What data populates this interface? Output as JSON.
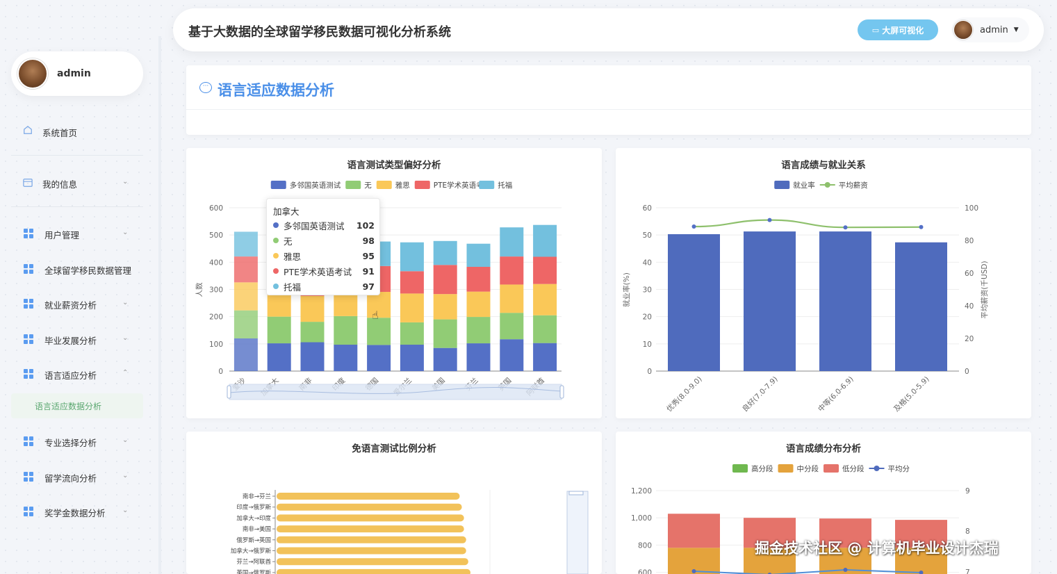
{
  "sidebar": {
    "user_name": "admin",
    "items": [
      {
        "label": "系统首页",
        "icon": "home-icon",
        "has_chevron": false
      },
      {
        "label": "我的信息",
        "icon": "card-icon",
        "has_chevron": true
      },
      {
        "label": "用户管理",
        "icon": "grid-icon",
        "has_chevron": true
      },
      {
        "label": "全球留学移民数据管理",
        "icon": "grid-icon",
        "has_chevron": false
      },
      {
        "label": "就业薪资分析",
        "icon": "grid-icon",
        "has_chevron": true
      },
      {
        "label": "毕业发展分析",
        "icon": "grid-icon",
        "has_chevron": true
      },
      {
        "label": "语言适应分析",
        "icon": "grid-icon",
        "has_chevron": true,
        "expanded": true
      },
      {
        "label": "专业选择分析",
        "icon": "grid-icon",
        "has_chevron": true
      },
      {
        "label": "留学流向分析",
        "icon": "grid-icon",
        "has_chevron": true
      },
      {
        "label": "奖学金数据分析",
        "icon": "grid-icon",
        "has_chevron": true
      }
    ],
    "active_sub_item": "语言适应数据分析"
  },
  "header": {
    "title": "基于大数据的全球留学移民数据可视化分析系统",
    "bigscreen_label": "大屏可视化",
    "user_name": "admin"
  },
  "page": {
    "title": "语言适应数据分析"
  },
  "colors": {
    "accent": "#4a8fe8",
    "blue": "#5470c6",
    "green": "#91cc75",
    "yellow": "#fac858",
    "red": "#ee6666",
    "cyan": "#73c0de",
    "bar_blue": "#4f6bbd",
    "line_green": "#8ec06c",
    "high": "#6fb84f",
    "mid": "#e4a33c",
    "low": "#e5736a"
  },
  "tooltip": {
    "title": "加拿大",
    "rows": [
      {
        "name": "多邻国英语测试",
        "value": "102",
        "color": "#5470c6"
      },
      {
        "name": "无",
        "value": "98",
        "color": "#91cc75"
      },
      {
        "name": "雅思",
        "value": "95",
        "color": "#fac858"
      },
      {
        "name": "PTE学术英语考试",
        "value": "91",
        "color": "#ee6666"
      },
      {
        "name": "托福",
        "value": "97",
        "color": "#73c0de"
      }
    ]
  },
  "watermark": "掘金技术社区 @ 计算机毕业设计杰瑞",
  "chart_data": [
    {
      "type": "bar",
      "stacked": true,
      "title": "语言测试类型偏好分析",
      "ylabel": "人数",
      "ylim": [
        0,
        600
      ],
      "yticks": [
        "0",
        "100",
        "200",
        "300",
        "400",
        "500",
        "600"
      ],
      "categories": [
        "爱沙",
        "加拿大",
        "南非",
        "印度",
        "德国",
        "爱尔兰",
        "美国",
        "芬兰",
        "英国",
        "阿联酋"
      ],
      "series": [
        {
          "name": "多邻国英语测试",
          "color": "#5470c6",
          "values": [
            120,
            102,
            106,
            97,
            96,
            97,
            85,
            102,
            117,
            103
          ]
        },
        {
          "name": "无",
          "color": "#91cc75",
          "values": [
            103,
            98,
            75,
            105,
            100,
            82,
            105,
            97,
            97,
            102
          ]
        },
        {
          "name": "雅思",
          "color": "#fac858",
          "values": [
            103,
            95,
            95,
            90,
            95,
            106,
            93,
            93,
            104,
            115
          ]
        },
        {
          "name": "PTE学术英语考试",
          "color": "#ee6666",
          "values": [
            95,
            91,
            105,
            96,
            95,
            82,
            107,
            91,
            103,
            100
          ]
        },
        {
          "name": "托福",
          "color": "#73c0de",
          "values": [
            91,
            97,
            120,
            106,
            90,
            106,
            88,
            85,
            107,
            117
          ]
        }
      ],
      "legend_position": "top-center"
    },
    {
      "type": "bar",
      "title": "语言成绩与就业关系",
      "categories": [
        "优秀(8.0-9.0)",
        "良好(7.0-7.9)",
        "中等(6.0-6.9)",
        "及格(5.0-5.9)"
      ],
      "ylabel": "就业率(%)",
      "y2label": "平均薪资(千USD)",
      "ylim": [
        0,
        60
      ],
      "y2lim": [
        0,
        100
      ],
      "yticks": [
        "0",
        "10",
        "20",
        "30",
        "40",
        "50",
        "60"
      ],
      "y2ticks": [
        "0",
        "20",
        "40",
        "60",
        "80",
        "100"
      ],
      "series": [
        {
          "name": "就业率",
          "type": "bar",
          "color": "#4f6bbd",
          "values": [
            50.3,
            51.3,
            51.3,
            47.3
          ]
        },
        {
          "name": "平均薪资",
          "type": "line",
          "color": "#8ec06c",
          "axis": "right",
          "values": [
            88.5,
            92.5,
            88.0,
            88.2
          ]
        }
      ],
      "legend_position": "top-center"
    },
    {
      "type": "bar",
      "orientation": "horizontal",
      "title": "免语言测试比例分析",
      "categories": [
        "南非→芬兰",
        "印度→俄罗斯",
        "加拿大→印度",
        "南非→美国",
        "俄罗斯→英国",
        "加拿大→俄罗斯",
        "芬兰→阿联酋",
        "英国→俄罗斯"
      ],
      "values": [
        85,
        86,
        87,
        87,
        88,
        88,
        89,
        90
      ]
    },
    {
      "type": "bar",
      "stacked": true,
      "title": "语言成绩分布分析",
      "ylim": [
        0,
        1200
      ],
      "yticks": [
        "600",
        "800",
        "1,000",
        "1,200"
      ],
      "y2ticks": [
        "7",
        "8",
        "9"
      ],
      "series": [
        {
          "name": "高分段",
          "color": "#6fb84f",
          "values": []
        },
        {
          "name": "中分段",
          "color": "#e4a33c",
          "values": []
        },
        {
          "name": "低分段",
          "color": "#e5736a",
          "values": []
        },
        {
          "name": "平均分",
          "type": "line",
          "color": "#4f6bbd",
          "values": []
        }
      ],
      "legend_position": "top-center"
    }
  ]
}
